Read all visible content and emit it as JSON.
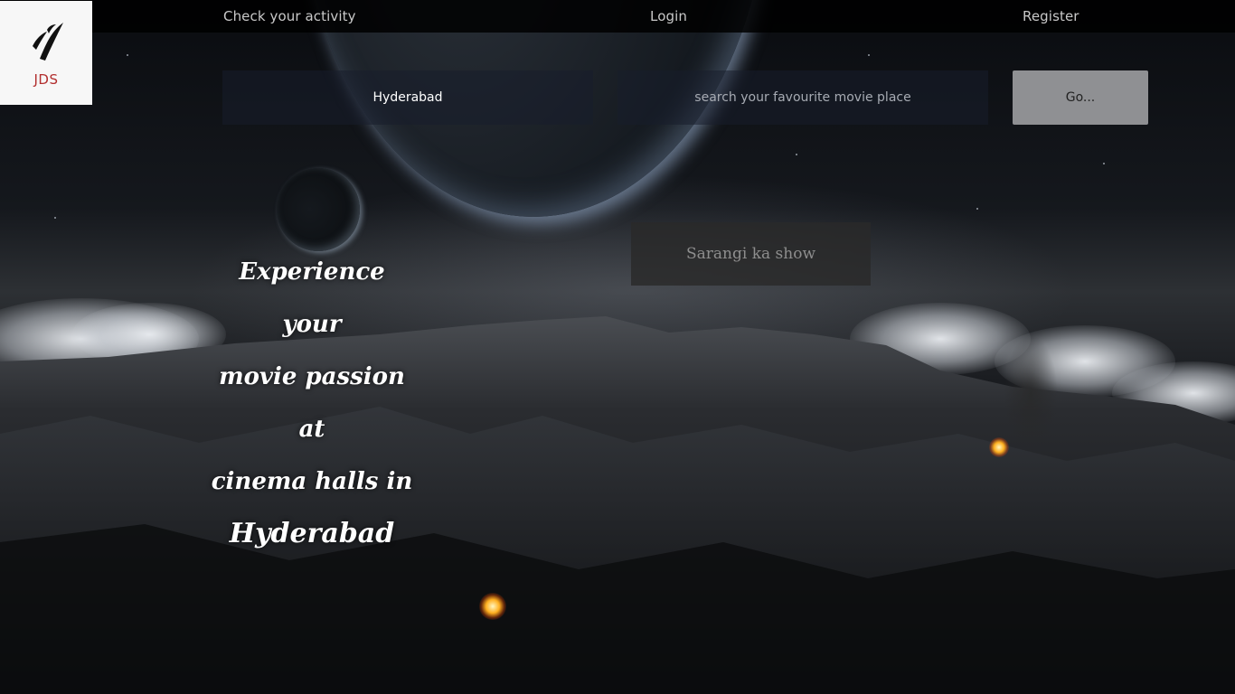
{
  "nav": {
    "activity": "Check your activity",
    "login": "Login",
    "register": "Register"
  },
  "logo": {
    "text": "JDS",
    "icon": "jds-logo-icon"
  },
  "search": {
    "city_value": "Hyderabad",
    "query_placeholder": "search your favourite movie place",
    "go_label": "Go..."
  },
  "featured": {
    "show": "Sarangi ka show"
  },
  "hero": {
    "line1": "Experience your",
    "line2": "movie passion at",
    "line3": "cinema halls in",
    "line4": "Hyderabad"
  },
  "colors": {
    "logo_text": "#b22e2e",
    "go_button": "#8f9093"
  }
}
